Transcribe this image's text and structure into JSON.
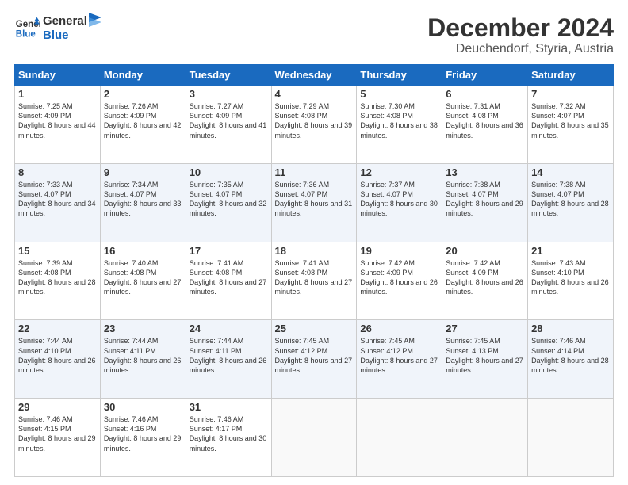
{
  "header": {
    "logo_line1": "General",
    "logo_line2": "Blue",
    "month": "December 2024",
    "location": "Deuchendorf, Styria, Austria"
  },
  "days_of_week": [
    "Sunday",
    "Monday",
    "Tuesday",
    "Wednesday",
    "Thursday",
    "Friday",
    "Saturday"
  ],
  "weeks": [
    [
      {
        "day": "1",
        "sunrise": "Sunrise: 7:25 AM",
        "sunset": "Sunset: 4:09 PM",
        "daylight": "Daylight: 8 hours and 44 minutes."
      },
      {
        "day": "2",
        "sunrise": "Sunrise: 7:26 AM",
        "sunset": "Sunset: 4:09 PM",
        "daylight": "Daylight: 8 hours and 42 minutes."
      },
      {
        "day": "3",
        "sunrise": "Sunrise: 7:27 AM",
        "sunset": "Sunset: 4:09 PM",
        "daylight": "Daylight: 8 hours and 41 minutes."
      },
      {
        "day": "4",
        "sunrise": "Sunrise: 7:29 AM",
        "sunset": "Sunset: 4:08 PM",
        "daylight": "Daylight: 8 hours and 39 minutes."
      },
      {
        "day": "5",
        "sunrise": "Sunrise: 7:30 AM",
        "sunset": "Sunset: 4:08 PM",
        "daylight": "Daylight: 8 hours and 38 minutes."
      },
      {
        "day": "6",
        "sunrise": "Sunrise: 7:31 AM",
        "sunset": "Sunset: 4:08 PM",
        "daylight": "Daylight: 8 hours and 36 minutes."
      },
      {
        "day": "7",
        "sunrise": "Sunrise: 7:32 AM",
        "sunset": "Sunset: 4:07 PM",
        "daylight": "Daylight: 8 hours and 35 minutes."
      }
    ],
    [
      {
        "day": "8",
        "sunrise": "Sunrise: 7:33 AM",
        "sunset": "Sunset: 4:07 PM",
        "daylight": "Daylight: 8 hours and 34 minutes."
      },
      {
        "day": "9",
        "sunrise": "Sunrise: 7:34 AM",
        "sunset": "Sunset: 4:07 PM",
        "daylight": "Daylight: 8 hours and 33 minutes."
      },
      {
        "day": "10",
        "sunrise": "Sunrise: 7:35 AM",
        "sunset": "Sunset: 4:07 PM",
        "daylight": "Daylight: 8 hours and 32 minutes."
      },
      {
        "day": "11",
        "sunrise": "Sunrise: 7:36 AM",
        "sunset": "Sunset: 4:07 PM",
        "daylight": "Daylight: 8 hours and 31 minutes."
      },
      {
        "day": "12",
        "sunrise": "Sunrise: 7:37 AM",
        "sunset": "Sunset: 4:07 PM",
        "daylight": "Daylight: 8 hours and 30 minutes."
      },
      {
        "day": "13",
        "sunrise": "Sunrise: 7:38 AM",
        "sunset": "Sunset: 4:07 PM",
        "daylight": "Daylight: 8 hours and 29 minutes."
      },
      {
        "day": "14",
        "sunrise": "Sunrise: 7:38 AM",
        "sunset": "Sunset: 4:07 PM",
        "daylight": "Daylight: 8 hours and 28 minutes."
      }
    ],
    [
      {
        "day": "15",
        "sunrise": "Sunrise: 7:39 AM",
        "sunset": "Sunset: 4:08 PM",
        "daylight": "Daylight: 8 hours and 28 minutes."
      },
      {
        "day": "16",
        "sunrise": "Sunrise: 7:40 AM",
        "sunset": "Sunset: 4:08 PM",
        "daylight": "Daylight: 8 hours and 27 minutes."
      },
      {
        "day": "17",
        "sunrise": "Sunrise: 7:41 AM",
        "sunset": "Sunset: 4:08 PM",
        "daylight": "Daylight: 8 hours and 27 minutes."
      },
      {
        "day": "18",
        "sunrise": "Sunrise: 7:41 AM",
        "sunset": "Sunset: 4:08 PM",
        "daylight": "Daylight: 8 hours and 27 minutes."
      },
      {
        "day": "19",
        "sunrise": "Sunrise: 7:42 AM",
        "sunset": "Sunset: 4:09 PM",
        "daylight": "Daylight: 8 hours and 26 minutes."
      },
      {
        "day": "20",
        "sunrise": "Sunrise: 7:42 AM",
        "sunset": "Sunset: 4:09 PM",
        "daylight": "Daylight: 8 hours and 26 minutes."
      },
      {
        "day": "21",
        "sunrise": "Sunrise: 7:43 AM",
        "sunset": "Sunset: 4:10 PM",
        "daylight": "Daylight: 8 hours and 26 minutes."
      }
    ],
    [
      {
        "day": "22",
        "sunrise": "Sunrise: 7:44 AM",
        "sunset": "Sunset: 4:10 PM",
        "daylight": "Daylight: 8 hours and 26 minutes."
      },
      {
        "day": "23",
        "sunrise": "Sunrise: 7:44 AM",
        "sunset": "Sunset: 4:11 PM",
        "daylight": "Daylight: 8 hours and 26 minutes."
      },
      {
        "day": "24",
        "sunrise": "Sunrise: 7:44 AM",
        "sunset": "Sunset: 4:11 PM",
        "daylight": "Daylight: 8 hours and 26 minutes."
      },
      {
        "day": "25",
        "sunrise": "Sunrise: 7:45 AM",
        "sunset": "Sunset: 4:12 PM",
        "daylight": "Daylight: 8 hours and 27 minutes."
      },
      {
        "day": "26",
        "sunrise": "Sunrise: 7:45 AM",
        "sunset": "Sunset: 4:12 PM",
        "daylight": "Daylight: 8 hours and 27 minutes."
      },
      {
        "day": "27",
        "sunrise": "Sunrise: 7:45 AM",
        "sunset": "Sunset: 4:13 PM",
        "daylight": "Daylight: 8 hours and 27 minutes."
      },
      {
        "day": "28",
        "sunrise": "Sunrise: 7:46 AM",
        "sunset": "Sunset: 4:14 PM",
        "daylight": "Daylight: 8 hours and 28 minutes."
      }
    ],
    [
      {
        "day": "29",
        "sunrise": "Sunrise: 7:46 AM",
        "sunset": "Sunset: 4:15 PM",
        "daylight": "Daylight: 8 hours and 29 minutes."
      },
      {
        "day": "30",
        "sunrise": "Sunrise: 7:46 AM",
        "sunset": "Sunset: 4:16 PM",
        "daylight": "Daylight: 8 hours and 29 minutes."
      },
      {
        "day": "31",
        "sunrise": "Sunrise: 7:46 AM",
        "sunset": "Sunset: 4:17 PM",
        "daylight": "Daylight: 8 hours and 30 minutes."
      },
      null,
      null,
      null,
      null
    ]
  ]
}
